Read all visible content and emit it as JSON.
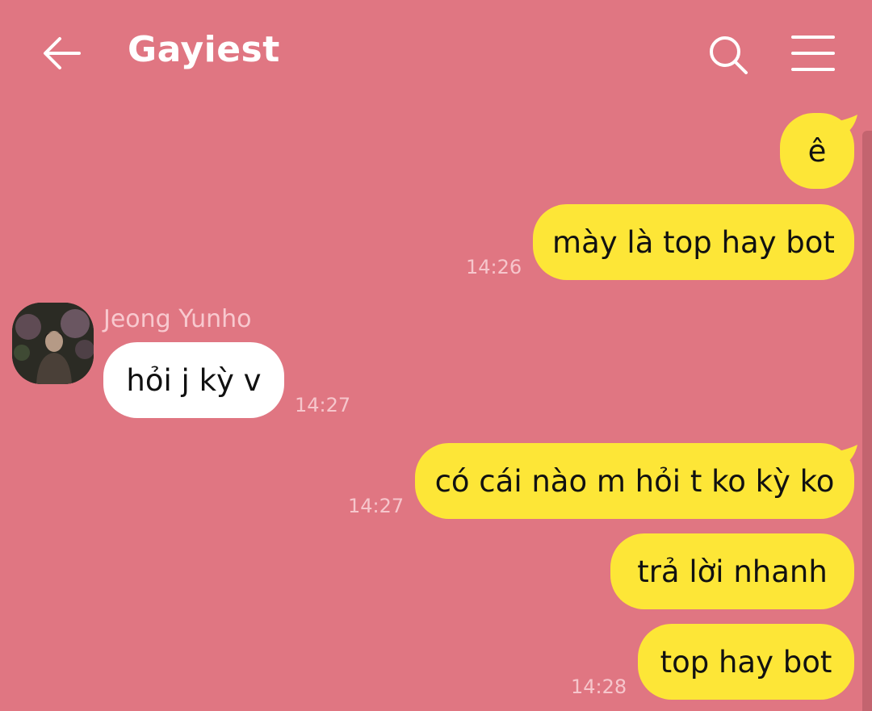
{
  "header": {
    "title": "Gayiest",
    "back_icon": "arrow-left-icon",
    "search_icon": "search-icon",
    "menu_icon": "hamburger-menu-icon"
  },
  "colors": {
    "background": "#e07682",
    "my_bubble": "#fde637",
    "other_bubble": "#ffffff",
    "timestamp": "#f6c6cc"
  },
  "messages": [
    {
      "text": "ê",
      "from": "me"
    },
    {
      "text": "mày là top hay bot",
      "from": "me",
      "time": "14:26"
    },
    {
      "text": "hỏi j kỳ v",
      "from": "other",
      "sender": "Jeong Yunho",
      "time": "14:27"
    },
    {
      "text": "có cái nào m hỏi t ko kỳ ko",
      "from": "me",
      "time": "14:27"
    },
    {
      "text": "trả lời nhanh",
      "from": "me"
    },
    {
      "text": "top hay bot",
      "from": "me",
      "time": "14:28"
    }
  ]
}
